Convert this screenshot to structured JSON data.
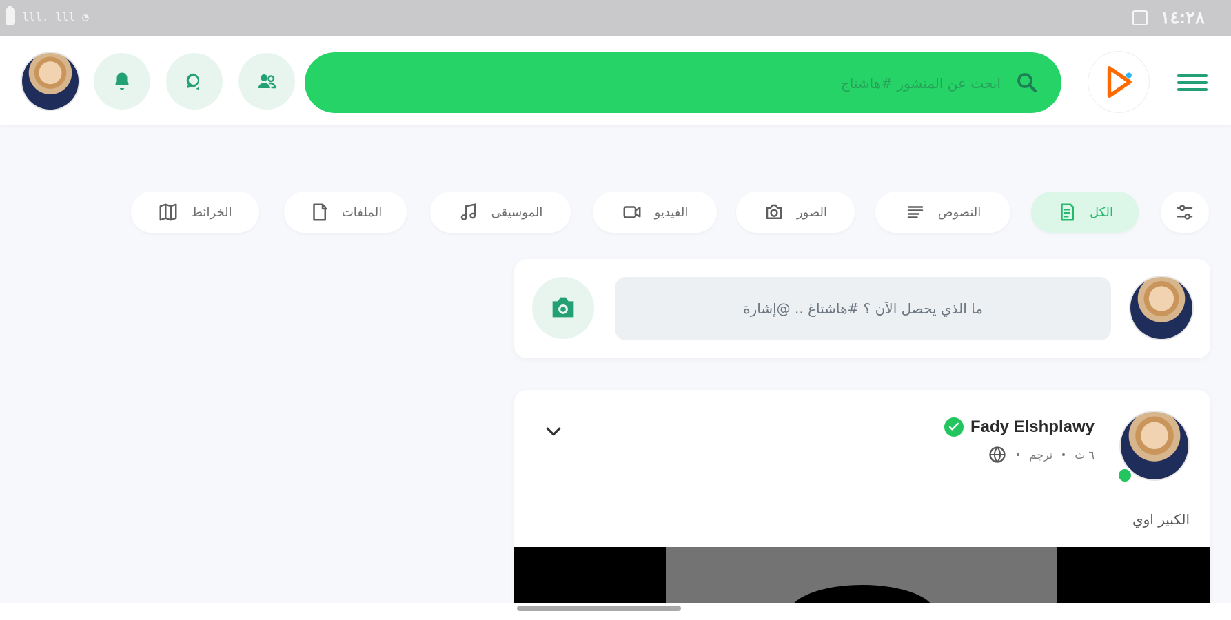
{
  "status_bar": {
    "left": "lll. lll",
    "time": "١٤:٢٨"
  },
  "header": {
    "search_placeholder": "ابحث عن المنشور #هاشتاج"
  },
  "filters": [
    {
      "label": "الكل",
      "icon": "document-icon",
      "active": true
    },
    {
      "label": "النصوص",
      "icon": "text-lines-icon",
      "active": false
    },
    {
      "label": "الصور",
      "icon": "camera-icon",
      "active": false
    },
    {
      "label": "الفيديو",
      "icon": "video-icon",
      "active": false
    },
    {
      "label": "الموسيقى",
      "icon": "music-icon",
      "active": false
    },
    {
      "label": "الملفات",
      "icon": "file-icon",
      "active": false
    },
    {
      "label": "الخرائط",
      "icon": "map-icon",
      "active": false
    }
  ],
  "composer": {
    "placeholder": "ما الذي يحصل الآن ؟ #هاشتاغ .. @إشارة"
  },
  "post": {
    "author": "Fady Elshplawy",
    "time": "٦ ث",
    "translate": "ترجم",
    "text": "الكبير اوي"
  },
  "colors": {
    "primary_green": "#25d366",
    "accent_teal": "#23a075",
    "light_green": "#e8f5ef"
  }
}
